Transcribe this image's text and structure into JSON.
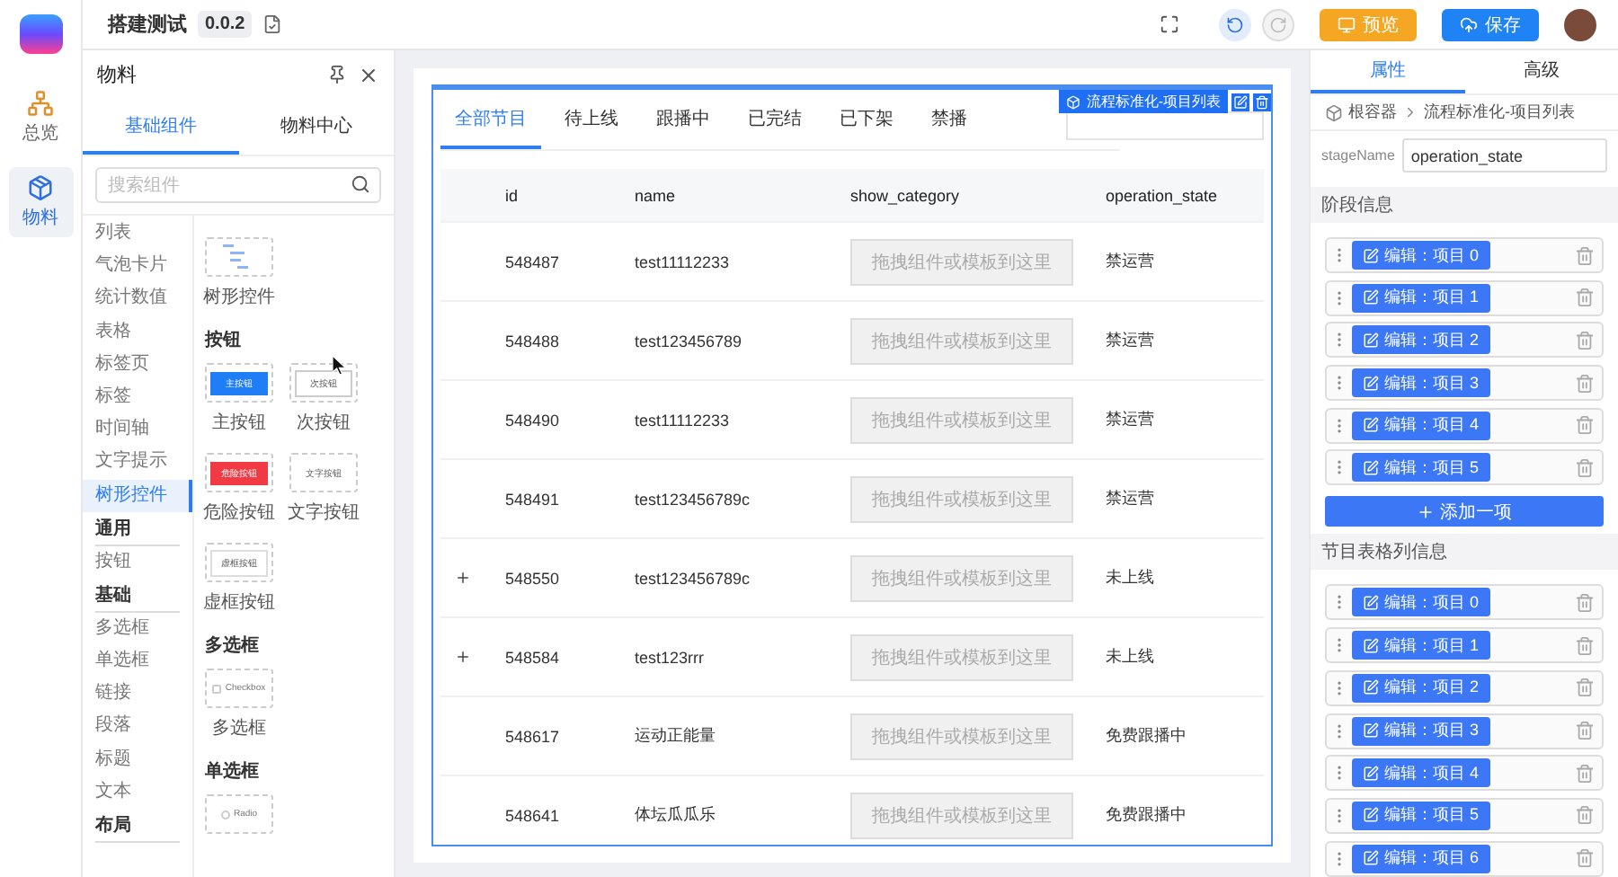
{
  "rail": {
    "items": [
      {
        "label": "总览",
        "selected": false,
        "kind": "overview"
      },
      {
        "label": "物料",
        "selected": true,
        "kind": "material"
      }
    ]
  },
  "topbar": {
    "title": "搭建测试",
    "version": "0.0.2",
    "undo_disabled": false,
    "redo_disabled": true,
    "preview_button": "预览",
    "save_button": "保存"
  },
  "materials": {
    "title": "物料",
    "tabs": [
      {
        "label": "基础组件",
        "selected": true
      },
      {
        "label": "物料中心",
        "selected": false
      }
    ],
    "search": {
      "placeholder": "搜索组件"
    },
    "categories": [
      {
        "kind": "item",
        "label": "列表",
        "selected": false
      },
      {
        "kind": "item",
        "label": "气泡卡片",
        "selected": false
      },
      {
        "kind": "item",
        "label": "统计数值",
        "selected": false
      },
      {
        "kind": "item",
        "label": "表格",
        "selected": false
      },
      {
        "kind": "item",
        "label": "标签页",
        "selected": false
      },
      {
        "kind": "item",
        "label": "标签",
        "selected": false
      },
      {
        "kind": "item",
        "label": "时间轴",
        "selected": false
      },
      {
        "kind": "item",
        "label": "文字提示",
        "selected": false
      },
      {
        "kind": "item",
        "label": "树形控件",
        "selected": true
      },
      {
        "kind": "heading",
        "label": "通用"
      },
      {
        "kind": "item",
        "label": "按钮",
        "selected": false
      },
      {
        "kind": "heading",
        "label": "基础"
      },
      {
        "kind": "item",
        "label": "多选框",
        "selected": false
      },
      {
        "kind": "item",
        "label": "单选框",
        "selected": false
      },
      {
        "kind": "item",
        "label": "链接",
        "selected": false
      },
      {
        "kind": "item",
        "label": "段落",
        "selected": false
      },
      {
        "kind": "item",
        "label": "标题",
        "selected": false
      },
      {
        "kind": "item",
        "label": "文本",
        "selected": false
      },
      {
        "kind": "heading",
        "label": "布局"
      }
    ],
    "sections": [
      {
        "cards": [
          {
            "kind": "tree",
            "label": "树形控件"
          }
        ]
      },
      {
        "heading": "按钮",
        "cards": [
          {
            "kind": "button",
            "preview_text": "主按钮",
            "label": "主按钮"
          },
          {
            "kind": "button",
            "preview_text": "次按钮",
            "label": "次按钮"
          },
          {
            "kind": "button",
            "preview_text": "危险按钮",
            "label": "危险按钮"
          },
          {
            "kind": "button",
            "preview_text": "文字按钮",
            "label": "文字按钮"
          },
          {
            "kind": "button",
            "preview_text": "虚框按钮",
            "label": "虚框按钮"
          }
        ]
      },
      {
        "heading": "多选框",
        "cards": [
          {
            "kind": "checkbox",
            "preview_text": "Checkbox",
            "label": "多选框"
          }
        ]
      },
      {
        "heading": "单选框",
        "cards": [
          {
            "kind": "radio",
            "preview_text": "Radio"
          }
        ]
      }
    ]
  },
  "canvas": {
    "component_label": "流程标准化-项目列表",
    "tabs": [
      {
        "label": "全部节目",
        "selected": true
      },
      {
        "label": "待上线",
        "selected": false
      },
      {
        "label": "跟播中",
        "selected": false
      },
      {
        "label": "已完结",
        "selected": false
      },
      {
        "label": "已下架",
        "selected": false
      },
      {
        "label": "禁播",
        "selected": false
      }
    ],
    "table": {
      "columns": [
        "id",
        "name",
        "show_category",
        "operation_state"
      ],
      "rows": [
        {
          "expandable": false,
          "id": "548487",
          "name": "test11112233",
          "show_category": "拖拽组件或模板到这里",
          "operation_state": "禁运营"
        },
        {
          "expandable": false,
          "id": "548488",
          "name": "test123456789",
          "show_category": "拖拽组件或模板到这里",
          "operation_state": "禁运营"
        },
        {
          "expandable": false,
          "id": "548490",
          "name": "test11112233",
          "show_category": "拖拽组件或模板到这里",
          "operation_state": "禁运营"
        },
        {
          "expandable": false,
          "id": "548491",
          "name": "test123456789c",
          "show_category": "拖拽组件或模板到这里",
          "operation_state": "禁运营"
        },
        {
          "expandable": true,
          "id": "548550",
          "name": "test123456789c",
          "show_category": "拖拽组件或模板到这里",
          "operation_state": "未上线"
        },
        {
          "expandable": true,
          "id": "548584",
          "name": "test123rrr",
          "show_category": "拖拽组件或模板到这里",
          "operation_state": "未上线"
        },
        {
          "expandable": false,
          "id": "548617",
          "name": "运动正能量",
          "show_category": "拖拽组件或模板到这里",
          "operation_state": "免费跟播中"
        },
        {
          "expandable": false,
          "id": "548641",
          "name": "体坛瓜瓜乐",
          "show_category": "拖拽组件或模板到这里",
          "operation_state": "免费跟播中"
        }
      ]
    }
  },
  "properties": {
    "tabs": [
      {
        "label": "属性",
        "selected": true
      },
      {
        "label": "高级",
        "selected": false
      }
    ],
    "breadcrumb": [
      "根容器",
      "流程标准化-项目列表"
    ],
    "field": {
      "label": "stageName",
      "value": "operation_state"
    },
    "sections": [
      {
        "title": "阶段信息",
        "items": [
          "编辑：项目 0",
          "编辑：项目 1",
          "编辑：项目 2",
          "编辑：项目 3",
          "编辑：项目 4",
          "编辑：项目 5"
        ],
        "add_button": "添加一项"
      },
      {
        "title": "节目表格列信息",
        "items": [
          "编辑：项目 0",
          "编辑：项目 1",
          "编辑：项目 2",
          "编辑：项目 3",
          "编辑：项目 4",
          "编辑：项目 5",
          "编辑：项目 6"
        ]
      }
    ]
  }
}
